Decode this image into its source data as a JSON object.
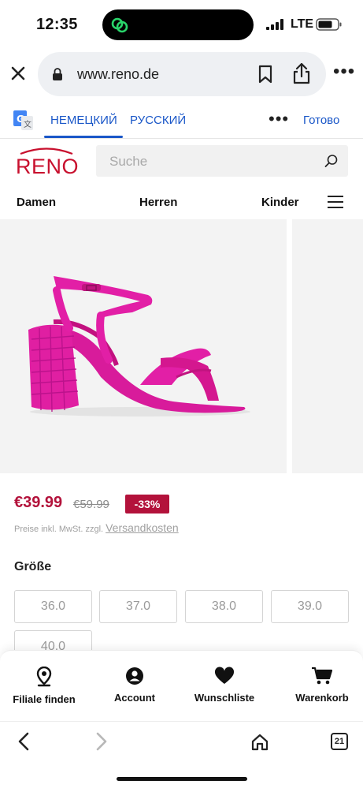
{
  "status_bar": {
    "time": "12:35",
    "network": "LTE",
    "icons": [
      "signal-icon",
      "battery-icon",
      "focus-icon"
    ]
  },
  "browser": {
    "url": "www.reno.de",
    "icons": [
      "close-icon",
      "lock-icon",
      "bookmark-icon",
      "share-icon",
      "more-icon"
    ]
  },
  "translate_bar": {
    "source_lang": "НЕМЕЦКИЙ",
    "target_lang": "РУССКИЙ",
    "done_label": "Готово",
    "more_label": "•••"
  },
  "site": {
    "logo_text": "RENO",
    "search_placeholder": "Suche",
    "brand_color": "#c8102e"
  },
  "categories": [
    {
      "label": "Damen"
    },
    {
      "label": "Herren"
    },
    {
      "label": "Kinder"
    }
  ],
  "product": {
    "image_desc_icon": "pink-block-heel-sandal",
    "price_current": "€39.99",
    "price_old": "€59.99",
    "discount": "-33%",
    "price_note": "Preise inkl. MwSt. zzgl.",
    "price_note_link": "Versandkosten",
    "accent_color": "#b3123b"
  },
  "sizes": {
    "title": "Größe",
    "options": [
      "36.0",
      "37.0",
      "38.0",
      "39.0",
      "40.0"
    ]
  },
  "bottom_nav": [
    {
      "label": "Filiale finden",
      "icon": "location-pin-icon"
    },
    {
      "label": "Account",
      "icon": "account-icon"
    },
    {
      "label": "Wunschliste",
      "icon": "heart-icon"
    },
    {
      "label": "Warenkorb",
      "icon": "cart-icon"
    }
  ],
  "browser_toolbar": {
    "tab_count": "21",
    "icons": [
      "back-icon",
      "forward-icon",
      "home-icon",
      "tabs-icon"
    ]
  }
}
